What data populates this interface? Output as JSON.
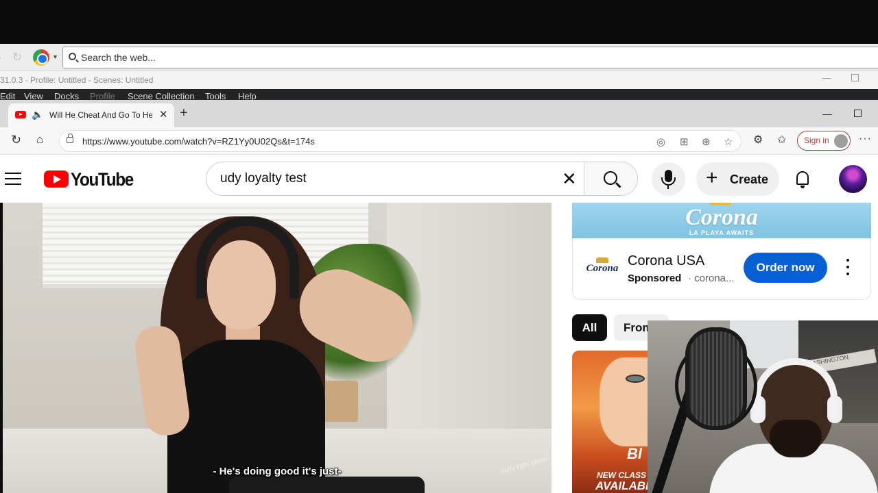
{
  "outer_browser": {
    "search_placeholder": "Search the web..."
  },
  "obs": {
    "title": "31.0.3 - Profile: Untitled - Scenes: Untitled",
    "menu": [
      "Edit",
      "View",
      "Docks",
      "Profile",
      "Scene Collection",
      "Tools",
      "Help"
    ]
  },
  "edge": {
    "tab_title": "Will He Cheat And Go To Her",
    "url": "https://www.youtube.com/watch?v=RZ1Yy0U02Qs&t=174s",
    "signin_label": "Sign in"
  },
  "youtube": {
    "logo_text": "YouTube",
    "search_query": "udy loyalty test",
    "create_label": "Create",
    "video_caption": "- He's doing good it's just-",
    "video_watermark": "curly light studio",
    "ad": {
      "banner_brand": "Corona",
      "banner_tagline": "LA PLAYA AWAITS",
      "logo_text": "Corona",
      "advertiser": "Corona USA",
      "sponsored_label": "Sponsored",
      "domain": "· corona...",
      "cta_label": "Order now"
    },
    "chips": [
      "All",
      "From"
    ],
    "thumbnail": {
      "text_big": "Bl",
      "text_small": "NEW CLASS",
      "text_medium": "AVAILABI"
    }
  },
  "webcam": {
    "sign_text": "ASHINGTON"
  },
  "icons": {
    "reload": "reload-icon",
    "home": "home-icon",
    "mic": "mic-icon",
    "bell": "bell-icon"
  },
  "colors": {
    "youtube_red": "#ff0000",
    "cta_blue": "#065fd4",
    "signin_red": "#b03a3a",
    "obs_menu_bg": "#232425"
  }
}
